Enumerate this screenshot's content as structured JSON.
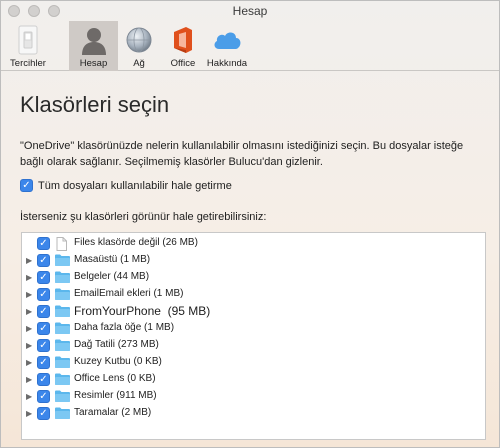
{
  "window": {
    "title": "Hesap"
  },
  "toolbar": {
    "tabs": [
      {
        "id": "tercihler",
        "label": "Tercihler",
        "icon": "switch-icon",
        "active": false
      },
      {
        "id": "hesap",
        "label": "Hesap",
        "icon": "person-icon",
        "active": true
      },
      {
        "id": "ag",
        "label": "Ağ",
        "icon": "network-globe-icon",
        "active": false
      },
      {
        "id": "office",
        "label": "Office",
        "icon": "office-icon",
        "active": false
      },
      {
        "id": "hakkinda",
        "label": "Hakkında",
        "icon": "cloud-icon",
        "active": false
      }
    ]
  },
  "main": {
    "heading": "Klasörleri seçin",
    "description": "\"OneDrive\" klasörünüzde nelerin kullanılabilir olmasını istediğinizi seçin. Bu dosyalar isteğe bağlı olarak sağlanır. Seçilmemiş klasörler Bulucu'dan gizlenir.",
    "all_files": {
      "label": "Tüm dosyaları kullanılabilir hale getirme",
      "checked": true
    },
    "list_label": "İsterseniz şu klasörleri görünür hale getirebilirsiniz:",
    "items": [
      {
        "label": "Files klasörde değil (26 MB)",
        "type": "file",
        "expandable": false,
        "checked": true
      },
      {
        "label": "Masaüstü (1 MB)",
        "type": "folder",
        "expandable": true,
        "checked": true
      },
      {
        "label": "Belgeler (44 MB)",
        "type": "folder",
        "expandable": true,
        "checked": true
      },
      {
        "label": "EmailEmail ekleri (1 MB)",
        "type": "folder",
        "expandable": true,
        "checked": true
      },
      {
        "label": "FromYourPhone  (95 MB)",
        "type": "folder",
        "expandable": true,
        "checked": true
      },
      {
        "label": "Daha fazla öğe (1 MB)",
        "type": "folder",
        "expandable": true,
        "checked": true
      },
      {
        "label": "Dağ Tatili (273 MB)",
        "type": "folder",
        "expandable": true,
        "checked": true
      },
      {
        "label": "Kuzey Kutbu (0 KB)",
        "type": "folder",
        "expandable": true,
        "checked": true
      },
      {
        "label": "Office Lens (0 KB)",
        "type": "folder",
        "expandable": true,
        "checked": true
      },
      {
        "label": "Resimler (911 MB)",
        "type": "folder",
        "expandable": true,
        "checked": true
      },
      {
        "label": "Taramalar (2 MB)",
        "type": "folder",
        "expandable": true,
        "checked": true
      }
    ]
  },
  "colors": {
    "checkbox": "#3b86ea",
    "folder": "#5bb7ec",
    "office": "#e0501c",
    "cloud": "#4b9de8",
    "active_tab": "#cfcac6"
  }
}
